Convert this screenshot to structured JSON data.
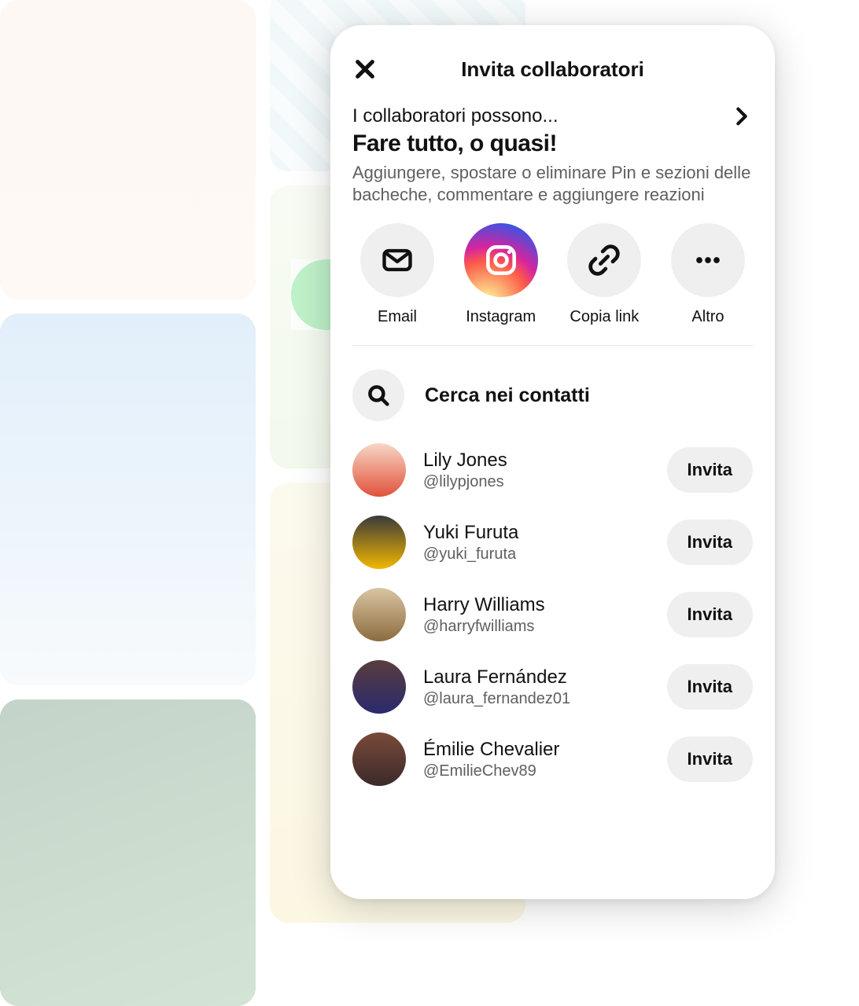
{
  "modal": {
    "title": "Invita collaboratori",
    "permission": {
      "label": "I collaboratori possono...",
      "headline": "Fare tutto, o quasi!",
      "description": "Aggiungere, spostare o eliminare Pin e sezioni delle bacheche, commentare e aggiungere reazioni"
    },
    "share": {
      "email": "Email",
      "instagram": "Instagram",
      "copy_link": "Copia link",
      "more": "Altro"
    },
    "search": {
      "placeholder": "Cerca nei contatti"
    },
    "invite_label": "Invita",
    "contacts": [
      {
        "name": "Lily Jones",
        "handle": "@lilypjones"
      },
      {
        "name": "Yuki Furuta",
        "handle": "@yuki_furuta"
      },
      {
        "name": "Harry Williams",
        "handle": "@harryfwilliams"
      },
      {
        "name": "Laura Fernández",
        "handle": "@laura_fernandez01"
      },
      {
        "name": "Émilie Chevalier",
        "handle": "@EmilieChev89"
      }
    ]
  }
}
